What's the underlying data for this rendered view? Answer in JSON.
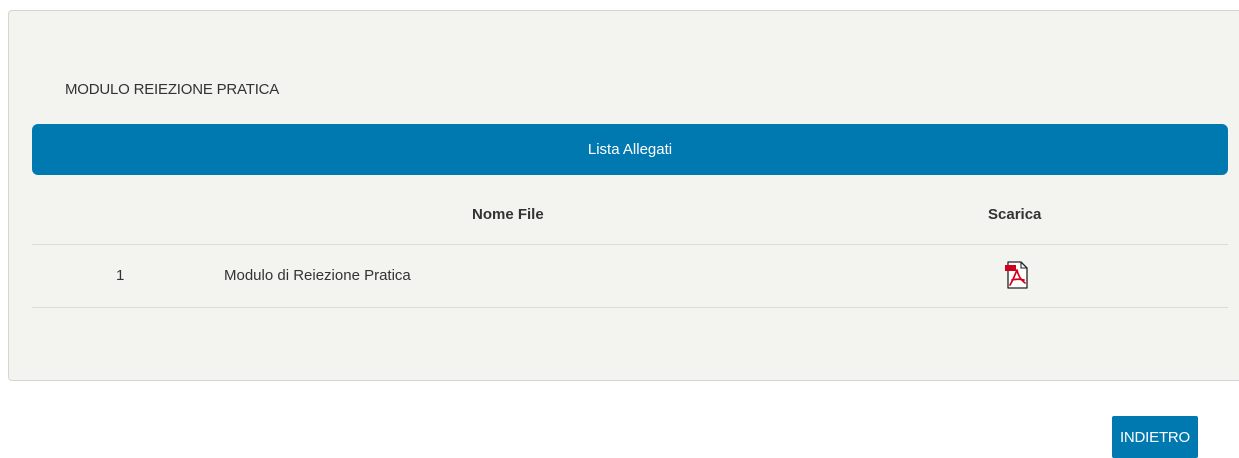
{
  "panel": {
    "title": "MODULO REIEZIONE PRATICA",
    "list_header": "Lista Allegati",
    "table": {
      "columns": [
        "",
        "Nome File",
        "Scarica"
      ],
      "rows": [
        {
          "index": "1",
          "file_name": "Modulo di Reiezione Pratica",
          "download_icon": "pdf-file-icon"
        }
      ]
    }
  },
  "actions": {
    "back_label": "INDIETRO"
  },
  "colors": {
    "accent": "#0079b0",
    "panel_bg": "#f3f3ef",
    "pdf_red": "#d0021b"
  }
}
